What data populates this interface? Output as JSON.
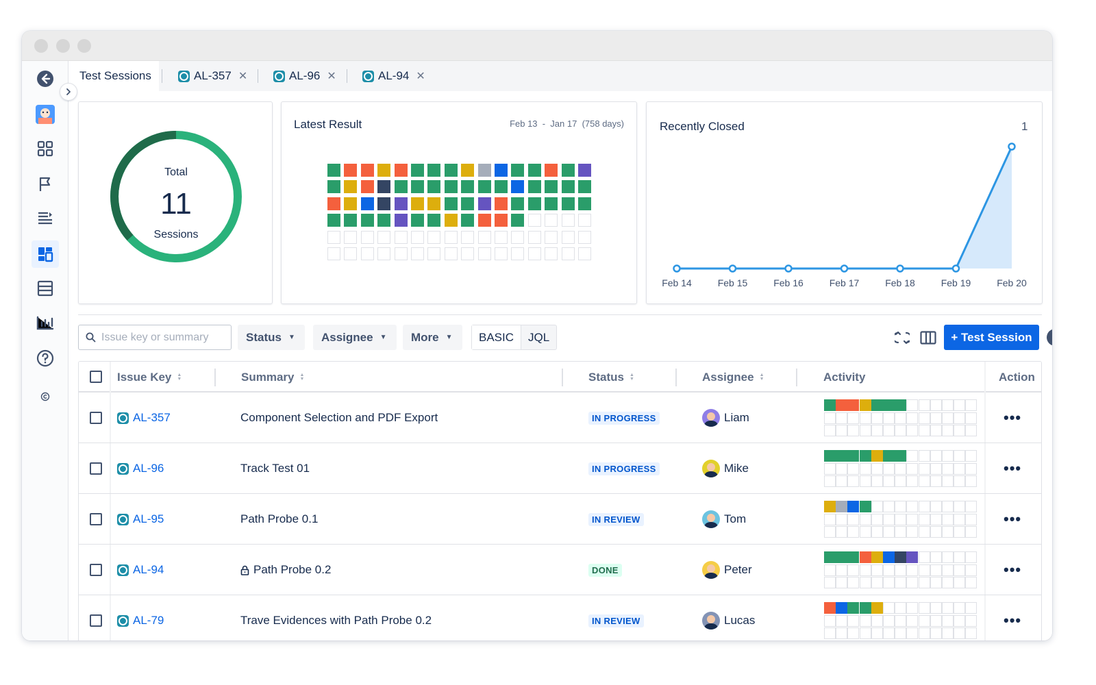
{
  "tabs": [
    {
      "label": "Test Sessions",
      "active": true
    },
    {
      "label": "AL-357",
      "closable": true
    },
    {
      "label": "AL-96",
      "closable": true
    },
    {
      "label": "AL-94",
      "closable": true
    }
  ],
  "sidebar": {
    "items": [
      "back-icon",
      "avatar-icon",
      "apps-icon",
      "flag-icon",
      "list-icon",
      "dashboard-icon",
      "layout-icon",
      "reports-icon",
      "help-icon",
      "copyright-icon"
    ]
  },
  "summary": {
    "label_top": "Total",
    "value": "11",
    "label_bottom": "Sessions",
    "ring_color": "#2ab27b",
    "ring_dark": "#1f6b4a"
  },
  "latest_result": {
    "title": "Latest Result",
    "range": "Feb 13  -  Jan 17  (758 days)",
    "colors": {
      "G": "#2a9d6a",
      "O": "#f4603d",
      "Y": "#ddae0d",
      "K": "#344563",
      "B": "#0c66e4",
      "P": "#6554c0",
      "S": "#a5adba",
      "E": "#ffffff"
    },
    "rows": [
      "GOOYOGGGYSBGGOGP",
      "GYOKGGGGGGGBGGGG",
      "OYBKPYYGGPOGGGGG",
      "GGGGPGGYGOOGEEEE",
      "EEEEEEEEEEEEEEEE",
      "EEEEEEEEEEEEEEEE"
    ]
  },
  "recently_closed": {
    "title": "Recently Closed",
    "peak_label": "1"
  },
  "chart_data": {
    "type": "area",
    "title": "Recently Closed",
    "categories": [
      "Feb 14",
      "Feb 15",
      "Feb 16",
      "Feb 17",
      "Feb 18",
      "Feb 19",
      "Feb 20"
    ],
    "values": [
      0,
      0,
      0,
      0,
      0,
      0,
      1
    ],
    "ylim": [
      0,
      1
    ],
    "grid": false,
    "line_color": "#2d96e3",
    "fill_color": "#d6e9fb"
  },
  "filters": {
    "search_placeholder": "Issue key or summary",
    "status": "Status",
    "assignee": "Assignee",
    "more": "More",
    "mode_basic": "BASIC",
    "mode_jql": "JQL",
    "new_session": "+ Test Session"
  },
  "table": {
    "headers": {
      "key": "Issue Key",
      "summary": "Summary",
      "status": "Status",
      "assignee": "Assignee",
      "activity": "Activity",
      "action": "Action"
    },
    "rows": [
      {
        "key": "AL-357",
        "summary": "Component Selection and PDF Export",
        "status": "IN PROGRESS",
        "status_kind": "progress",
        "assignee": "Liam",
        "avatar_color": "#8f7ee7",
        "locked": false,
        "activity": "GOOYGGG"
      },
      {
        "key": "AL-96",
        "summary": "Track Test 01",
        "status": "IN PROGRESS",
        "status_kind": "progress",
        "assignee": "Mike",
        "avatar_color": "#e2d02b",
        "locked": false,
        "activity": "GGGGYGG"
      },
      {
        "key": "AL-95",
        "summary": "Path Probe 0.1",
        "status": "IN REVIEW",
        "status_kind": "review",
        "assignee": "Tom",
        "avatar_color": "#6cc3e0",
        "locked": false,
        "activity": "YSBG"
      },
      {
        "key": "AL-94",
        "summary": "Path Probe 0.2",
        "status": "DONE",
        "status_kind": "done",
        "assignee": "Peter",
        "avatar_color": "#f5cd47",
        "locked": true,
        "activity": "GGGOYBKP"
      },
      {
        "key": "AL-79",
        "summary": "Trave Evidences with Path Probe 0.2",
        "status": "IN REVIEW",
        "status_kind": "review",
        "assignee": "Lucas",
        "avatar_color": "#8393b5",
        "locked": false,
        "activity": "OBGGY"
      }
    ]
  }
}
